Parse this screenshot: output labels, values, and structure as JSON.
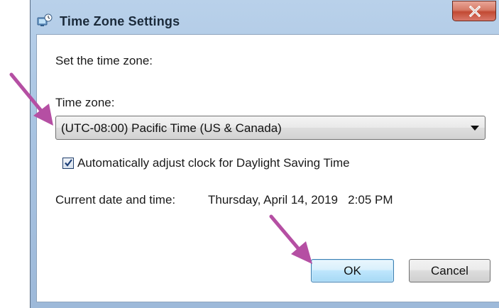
{
  "window": {
    "title": "Time Zone Settings",
    "icon": "world-clock-icon",
    "close_icon": "close-icon"
  },
  "dialog": {
    "heading": "Set the time zone:",
    "timezone_label": "Time zone:",
    "timezone_value": "(UTC-08:00) Pacific Time (US & Canada)",
    "dst_checkbox_label": "Automatically adjust clock for Daylight Saving Time",
    "dst_checked": true,
    "current_label": "Current date and time:",
    "current_value": "Thursday, April 14, 2019   2:05 PM",
    "ok_label": "OK",
    "cancel_label": "Cancel"
  },
  "annotations": {
    "arrow_color": "#b54fa3"
  },
  "colors": {
    "title_bar": "#a9c4e2",
    "close_button": "#c24a33",
    "ok_button_border": "#3c7fb1"
  }
}
